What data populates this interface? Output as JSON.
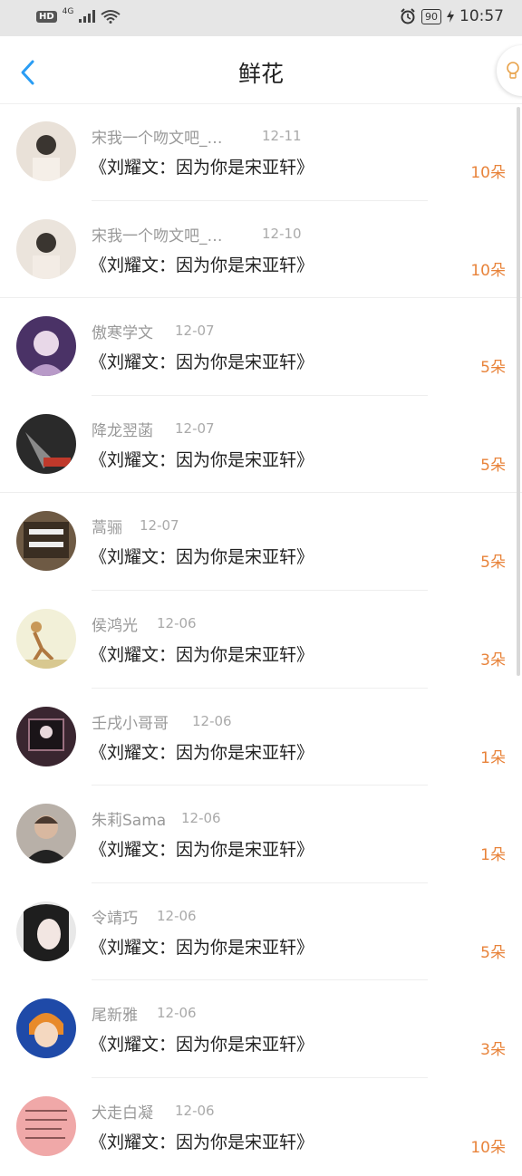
{
  "status_bar": {
    "hd": "HD",
    "network": "4G",
    "battery": "90",
    "time": "10:57"
  },
  "header": {
    "title": "鲜花",
    "back_icon": "chevron-left-icon"
  },
  "colors": {
    "accent": "#2a9df4",
    "count": "#e8833a",
    "name": "#999999",
    "text": "#222222"
  },
  "items": [
    {
      "name": "宋我一个吻文吧_…",
      "date": "12-11",
      "book": "《刘耀文：因为你是宋亚轩》",
      "count": "10朵"
    },
    {
      "name": "宋我一个吻文吧_…",
      "date": "12-10",
      "book": "《刘耀文：因为你是宋亚轩》",
      "count": "10朵"
    },
    {
      "name": "傲寒学文",
      "date": "12-07",
      "book": "《刘耀文：因为你是宋亚轩》",
      "count": "5朵"
    },
    {
      "name": "降龙翌菡",
      "date": "12-07",
      "book": "《刘耀文：因为你是宋亚轩》",
      "count": "5朵"
    },
    {
      "name": "蒿骊",
      "date": "12-07",
      "book": "《刘耀文：因为你是宋亚轩》",
      "count": "5朵"
    },
    {
      "name": "侯鸿光",
      "date": "12-06",
      "book": "《刘耀文：因为你是宋亚轩》",
      "count": "3朵"
    },
    {
      "name": "壬戌小哥哥",
      "date": "12-06",
      "book": "《刘耀文：因为你是宋亚轩》",
      "count": "1朵"
    },
    {
      "name": "朱莉Sama",
      "date": "12-06",
      "book": "《刘耀文：因为你是宋亚轩》",
      "count": "1朵"
    },
    {
      "name": "令靖巧",
      "date": "12-06",
      "book": "《刘耀文：因为你是宋亚轩》",
      "count": "5朵"
    },
    {
      "name": "尾新雅",
      "date": "12-06",
      "book": "《刘耀文：因为你是宋亚轩》",
      "count": "3朵"
    },
    {
      "name": "犬走白凝",
      "date": "12-06",
      "book": "《刘耀文：因为你是宋亚轩》",
      "count": "10朵"
    }
  ]
}
